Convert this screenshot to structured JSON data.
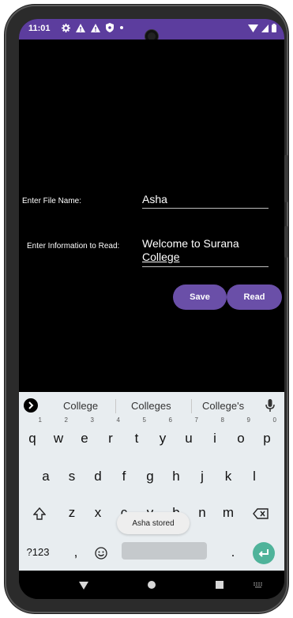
{
  "status_bar": {
    "time": "11:01",
    "icons": [
      "settings-icon",
      "warning-icon",
      "warning-icon",
      "shield-icon",
      "dot-icon"
    ],
    "right_icons": [
      "wifi-icon",
      "signal-icon",
      "battery-icon"
    ],
    "color": "#5c3d9e"
  },
  "form": {
    "file_label": "Enter File Name:",
    "file_value": "Asha",
    "info_label": "Enter Information to Read:",
    "info_value_line1": "Welcome to Surana",
    "info_value_line2": "College"
  },
  "buttons": {
    "save_label": "Save",
    "read_label": "Read",
    "color": "#6a4fa8"
  },
  "keyboard": {
    "suggestions": [
      "College",
      "Colleges",
      "College's"
    ],
    "row1": [
      "q",
      "w",
      "e",
      "r",
      "t",
      "y",
      "u",
      "i",
      "o",
      "p"
    ],
    "row1_numbers": [
      "1",
      "2",
      "3",
      "4",
      "5",
      "6",
      "7",
      "8",
      "9",
      "0"
    ],
    "row2": [
      "a",
      "s",
      "d",
      "f",
      "g",
      "h",
      "j",
      "k",
      "l"
    ],
    "row3": [
      "z",
      "x",
      "c",
      "v",
      "b",
      "n",
      "m"
    ],
    "symbols_label": "?123",
    "comma": ",",
    "period": ".",
    "background": "#e8edf0",
    "enter_color": "#4fb39a"
  },
  "toast": {
    "text": "Asha stored"
  },
  "nav": {
    "icons": [
      "back-icon",
      "home-icon",
      "recents-icon",
      "keyboard-icon"
    ]
  }
}
